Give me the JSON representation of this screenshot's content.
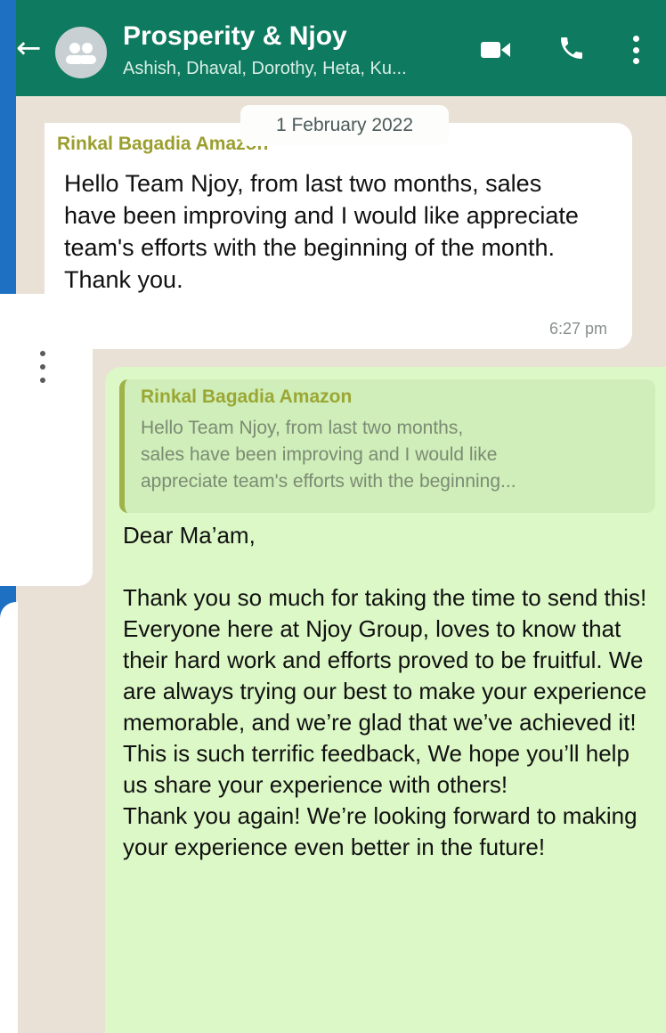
{
  "header": {
    "title": "Prosperity & Njoy",
    "subtitle": "Ashish, Dhaval, Dorothy, Heta, Ku...",
    "back_icon": "arrow-left-icon",
    "avatar_icon": "group-avatar-icon",
    "video_icon": "video-camera-icon",
    "call_icon": "phone-icon",
    "menu_icon": "more-vertical-icon"
  },
  "date_chip": "1 February 2022",
  "incoming_message": {
    "sender": "Rinkal Bagadia Amazon",
    "text": "Hello Team Njoy, from last two months, sales have been improving and I would like appreciate team's efforts with the beginning of the month. Thank you.",
    "time": "6:27 pm"
  },
  "outgoing_message": {
    "quoted_sender": "Rinkal Bagadia Amazon",
    "quoted_text": "Hello Team Njoy, from last two months,\nsales have been improving and I would like\nappreciate team's efforts with the beginning...",
    "text": "Dear Ma’am,\n\nThank you so much for taking the time to send this! Everyone here at Njoy Group, loves to know that their hard work and efforts proved to be fruitful. We are always trying our best to make your experience memorable, and we’re glad that we’ve achieved it!\nThis is such terrific feedback, We hope you’ll help us share your experience with others!\nThank you again! We’re looking forward to making your experience even better in the future!"
  },
  "colors": {
    "header_bg": "#0e7a5f",
    "chat_bg": "#e9e1d6",
    "incoming_bubble": "#ffffff",
    "outgoing_bubble": "#dcf8c6",
    "sender_name": "#9b9e2e"
  }
}
